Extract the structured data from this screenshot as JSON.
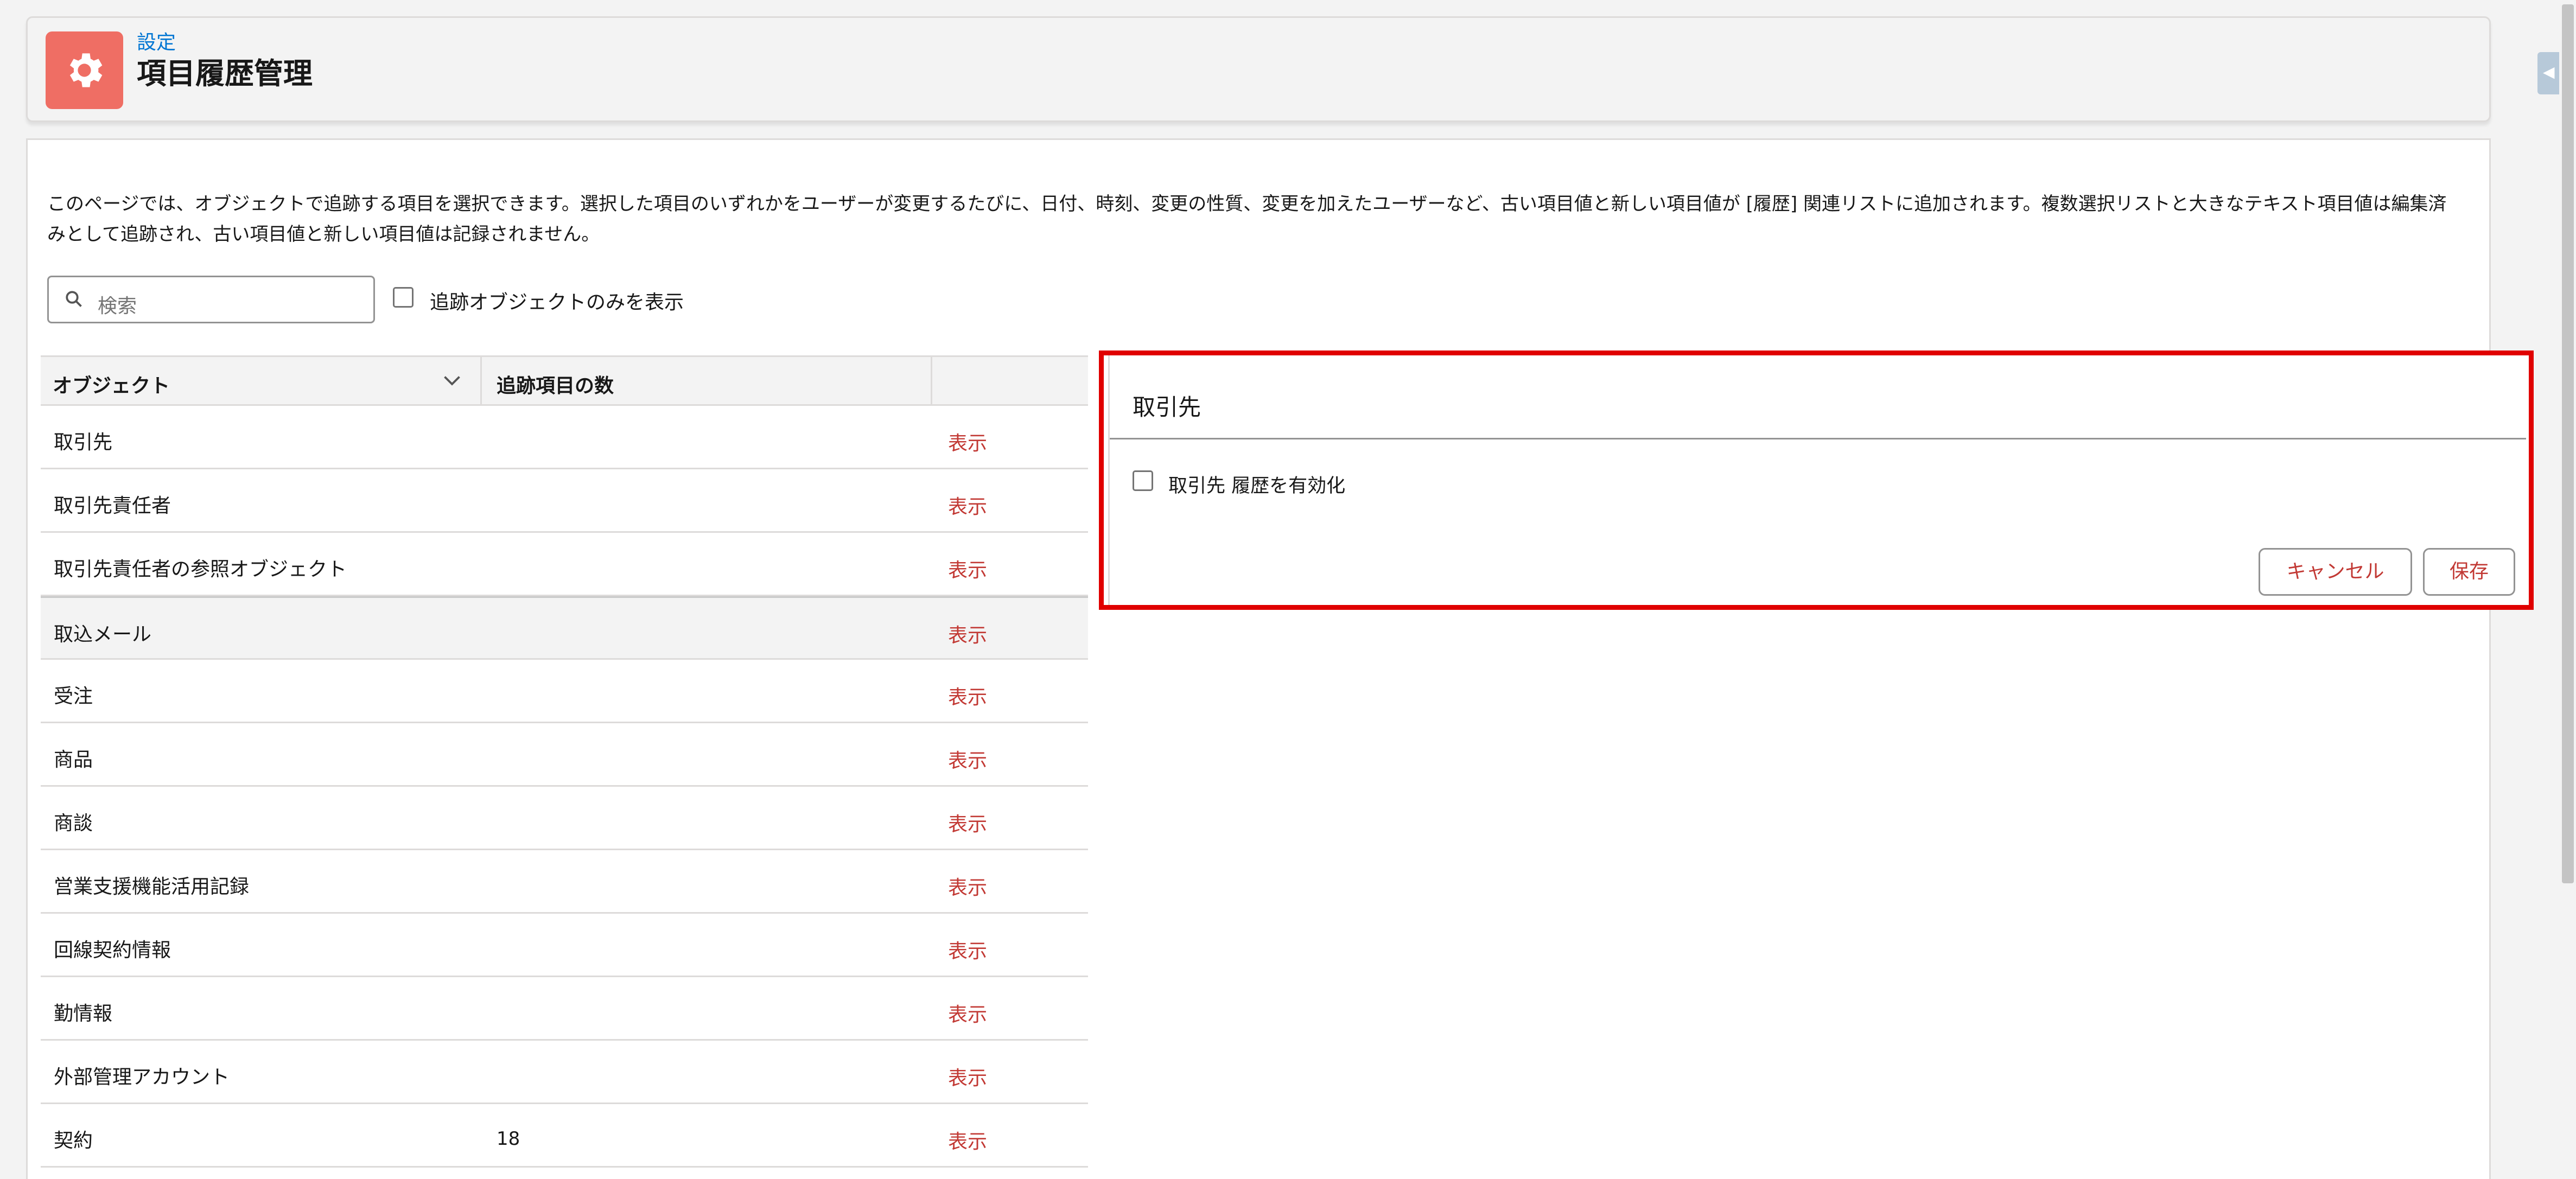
{
  "header": {
    "breadcrumb": "設定",
    "title": "項目履歴管理",
    "icon": "gear-icon",
    "icon_color": "#ef6e64"
  },
  "description": "このページでは、オブジェクトで追跡する項目を選択できます。選択した項目のいずれかをユーザーが変更するたびに、日付、時刻、変更の性質、変更を加えたユーザーなど、古い項目値と新しい項目値が [履歴] 関連リストに追加されます。複数選択リストと大きなテキスト項目値は編集済みとして追跡され、古い項目値と新しい項目値は記録されません。",
  "search": {
    "placeholder": "検索"
  },
  "filter": {
    "label": "追跡オブジェクトのみを表示"
  },
  "table": {
    "headers": {
      "object": "オブジェクト",
      "count": "追跡項目の数"
    },
    "rows": [
      {
        "name": "取引先",
        "count": "",
        "action": "表示"
      },
      {
        "name": "取引先責任者",
        "count": "",
        "action": "表示"
      },
      {
        "name": "取引先責任者の参照オブジェクト",
        "count": "",
        "action": "表示"
      },
      {
        "name": "取込メール",
        "count": "",
        "action": "表示"
      },
      {
        "name": "受注",
        "count": "",
        "action": "表示"
      },
      {
        "name": "商品",
        "count": "",
        "action": "表示"
      },
      {
        "name": "商談",
        "count": "",
        "action": "表示"
      },
      {
        "name": "営業支援機能活用記録",
        "count": "",
        "action": "表示"
      },
      {
        "name": "回線契約情報",
        "count": "",
        "action": "表示"
      },
      {
        "name": "勤情報",
        "count": "",
        "action": "表示"
      },
      {
        "name": "外部管理アカウント",
        "count": "",
        "action": "表示"
      },
      {
        "name": "契約",
        "count": "18",
        "action": "表示"
      }
    ]
  },
  "panel": {
    "title": "取引先",
    "enable_label": "取引先 履歴を有効化",
    "cancel_label": "キャンセル",
    "save_label": "保存",
    "highlight_color": "#e00000"
  }
}
